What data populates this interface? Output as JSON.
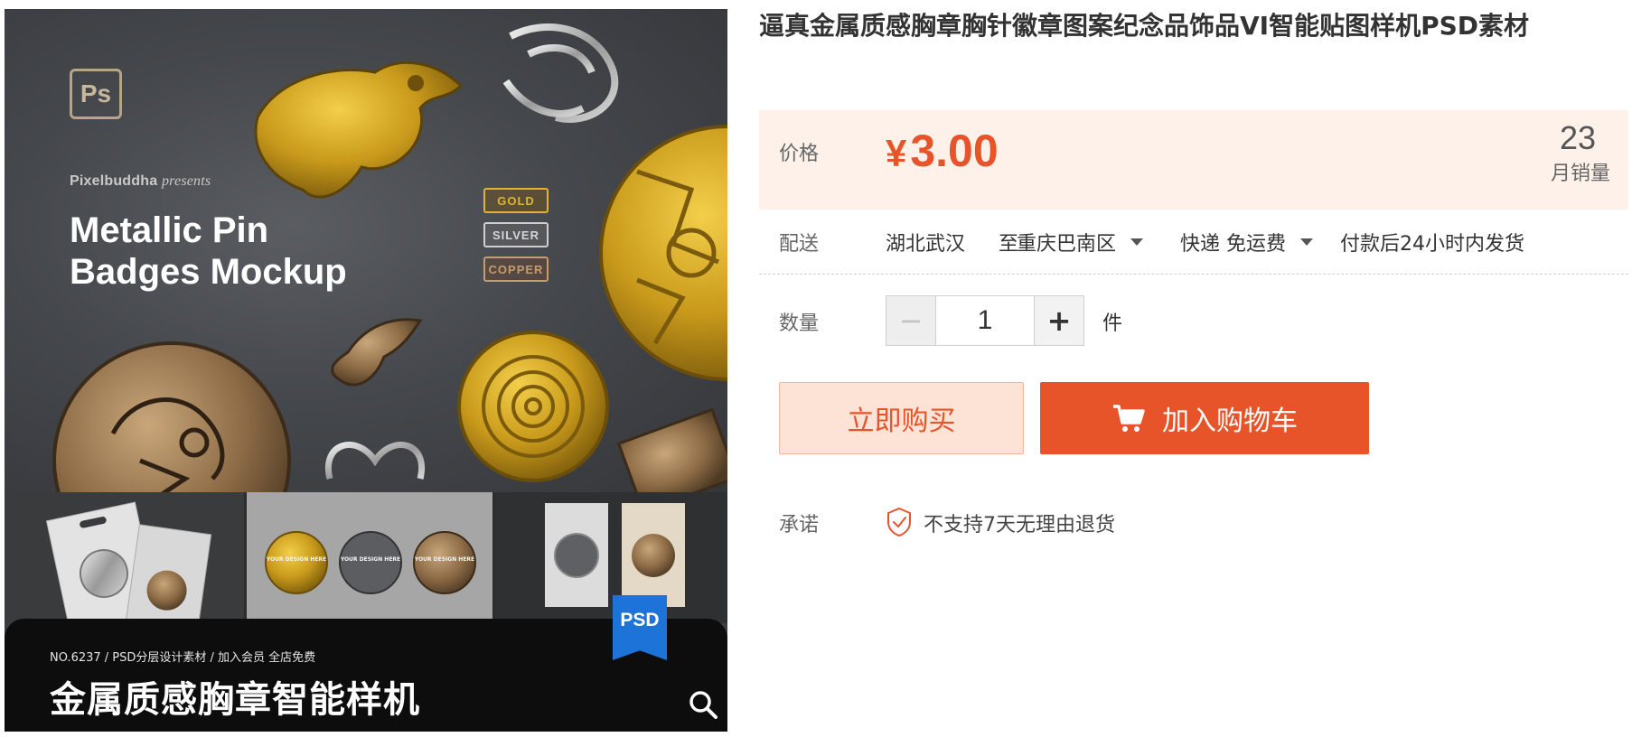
{
  "gallery": {
    "ps_logo": "Ps",
    "presenter_name": "Pixelbuddha",
    "presenter_suffix": "presents",
    "hero_title_line1": "Metallic Pin",
    "hero_title_line2": "Badges Mockup",
    "metal_tags": [
      "GOLD",
      "SILVER",
      "COPPER"
    ],
    "badge_text": "YOUR DESIGN HERE",
    "psd_ribbon": "PSD",
    "banner_meta": "NO.6237 / PSD分层设计素材 / 加入会员 全店免费",
    "banner_title": "金属质感胸章智能样机",
    "zoom_icon": "search-icon"
  },
  "product": {
    "title": "逼真金属质感胸章胸针徽章图案纪念品饰品VI智能贴图样机PSD素材",
    "price_label": "价格",
    "currency": "¥",
    "price": "3.00",
    "monthly_sales": "23",
    "monthly_sales_label": "月销量",
    "shipping_label": "配送",
    "ship_from": "湖北武汉",
    "ship_to_word": "至",
    "ship_to": "重庆巴南区",
    "ship_method": "快递 免运费",
    "ship_time": "付款后24小时内发货",
    "quantity_label": "数量",
    "quantity_minus": "−",
    "quantity_value": "1",
    "quantity_plus": "+",
    "quantity_unit": "件",
    "buy_now": "立即购买",
    "add_to_cart": "加入购物车",
    "promise_label": "承诺",
    "promise_text": "不支持7天无理由退货"
  },
  "colors": {
    "accent": "#e8542a",
    "price_bg": "#fdf1ea",
    "buy_now_bg": "#fde3d6",
    "psd_ribbon": "#1e73d8"
  }
}
